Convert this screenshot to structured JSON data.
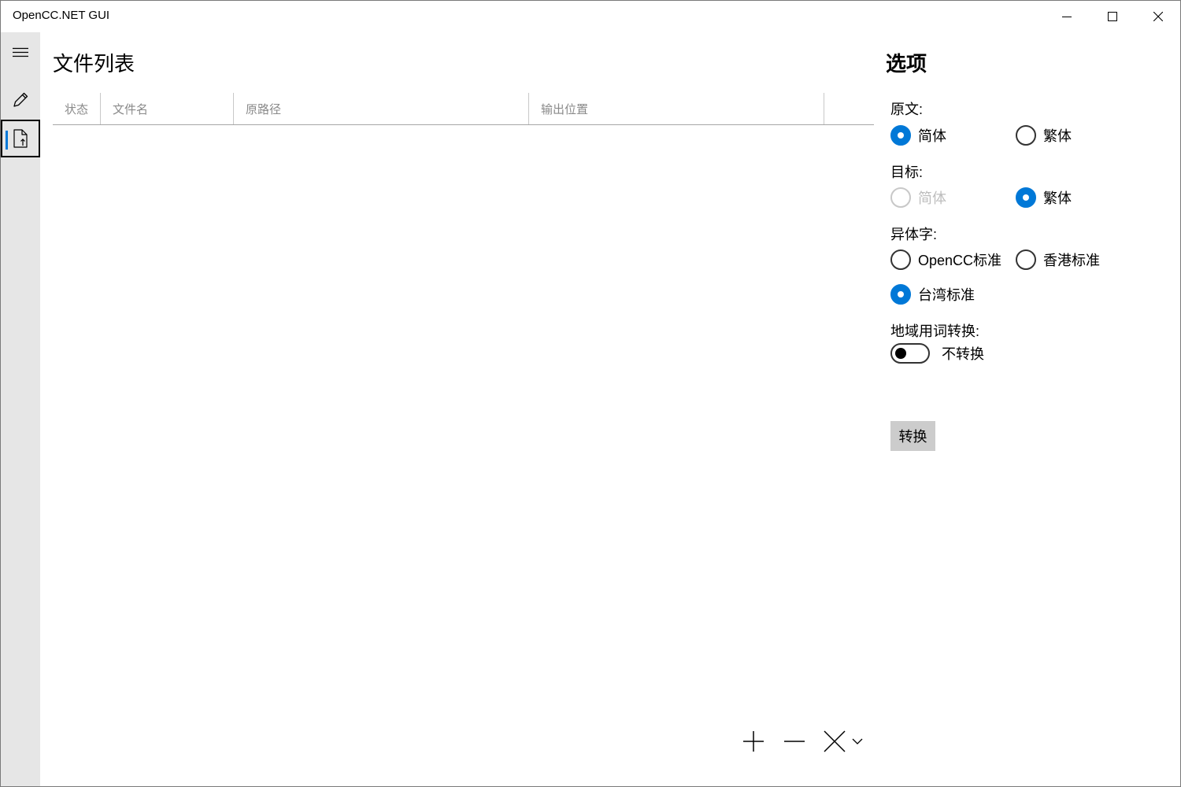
{
  "window": {
    "title": "OpenCC.NET GUI"
  },
  "titlebar_buttons": {
    "minimize": "minimize-icon",
    "maximize": "maximize-icon",
    "close": "close-icon"
  },
  "nav": {
    "items": [
      {
        "icon": "hamburger-menu-icon"
      },
      {
        "icon": "pencil-icon"
      },
      {
        "icon": "file-upload-icon",
        "selected": true
      }
    ]
  },
  "file_list": {
    "title": "文件列表",
    "columns": [
      "状态",
      "文件名",
      "原路径",
      "输出位置"
    ],
    "rows": []
  },
  "commands": {
    "add": "plus-icon",
    "remove": "minus-icon",
    "clear": "x-icon",
    "more": "chevron-down-icon"
  },
  "options": {
    "title": "选项",
    "source": {
      "label": "原文:",
      "choices": [
        {
          "label": "简体",
          "checked": true
        },
        {
          "label": "繁体",
          "checked": false
        }
      ]
    },
    "target": {
      "label": "目标:",
      "choices": [
        {
          "label": "简体",
          "checked": false,
          "disabled": true
        },
        {
          "label": "繁体",
          "checked": true
        }
      ]
    },
    "variant": {
      "label": "异体字:",
      "choices": [
        {
          "label": "OpenCC标准",
          "checked": false
        },
        {
          "label": "香港标准",
          "checked": false
        },
        {
          "label": "台湾标准",
          "checked": true
        }
      ]
    },
    "region": {
      "label": "地域用词转换:",
      "toggle_on": false,
      "toggle_text": "不转换"
    },
    "convert_button": "转换"
  },
  "colors": {
    "accent": "#0078d7",
    "nav_bg": "#e6e6e6",
    "button_bg": "#cccccc"
  }
}
